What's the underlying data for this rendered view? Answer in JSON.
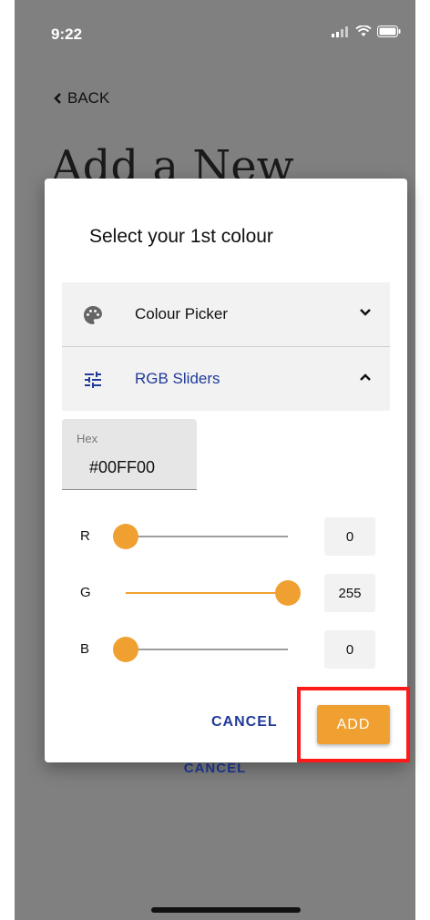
{
  "status_bar": {
    "time": "9:22"
  },
  "header": {
    "back_label": "BACK",
    "title": "Add a New"
  },
  "background": {
    "cancel_label": "CANCEL"
  },
  "dialog": {
    "title": "Select your 1st colour",
    "sections": [
      {
        "label": "Colour Picker",
        "icon": "palette-icon",
        "expanded": false
      },
      {
        "label": "RGB Sliders",
        "icon": "tune-icon",
        "expanded": true
      }
    ],
    "hex": {
      "label": "Hex",
      "value": "#00FF00"
    },
    "sliders": [
      {
        "channel": "R",
        "value": "0",
        "level": 0
      },
      {
        "channel": "G",
        "value": "255",
        "level": 1
      },
      {
        "channel": "B",
        "value": "0",
        "level": 0
      }
    ],
    "actions": {
      "cancel_label": "CANCEL",
      "add_label": "ADD"
    }
  },
  "colors": {
    "accent": "#f0a030",
    "link": "#203a9a",
    "highlight": "#ff1a1a"
  }
}
